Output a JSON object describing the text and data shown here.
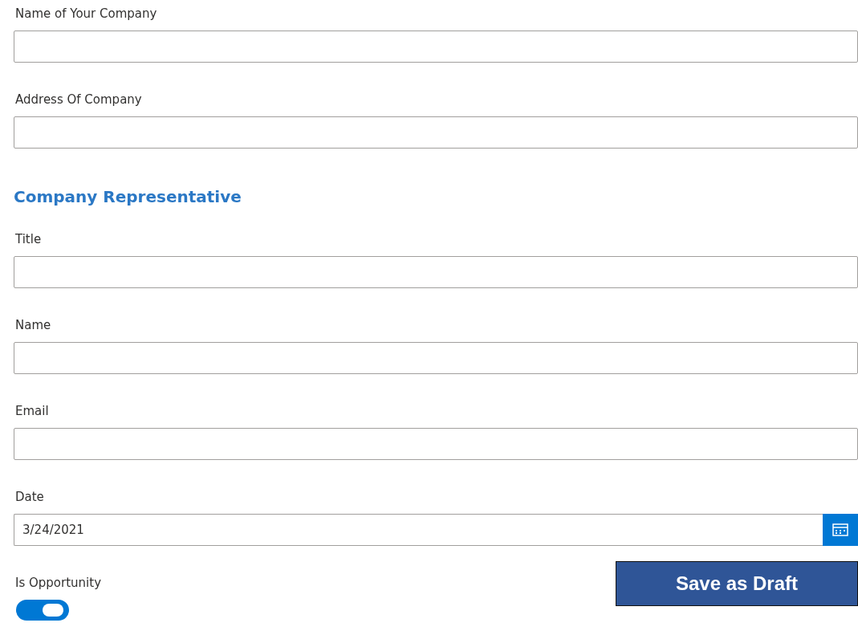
{
  "sections": [
    {
      "kind": "field",
      "label": "Name of Your Company"
    },
    {
      "kind": "field",
      "label": "Address Of Company"
    },
    {
      "kind": "heading",
      "text": "Company Representative"
    },
    {
      "kind": "field",
      "label": "Title"
    },
    {
      "kind": "field",
      "label": "Name"
    },
    {
      "kind": "field",
      "label": "Email"
    },
    {
      "kind": "date",
      "label": "Date",
      "value": "3/24/2021"
    }
  ],
  "toggle": {
    "label": "Is Opportunity",
    "on": true
  },
  "save_button": {
    "label": "Save as Draft"
  }
}
